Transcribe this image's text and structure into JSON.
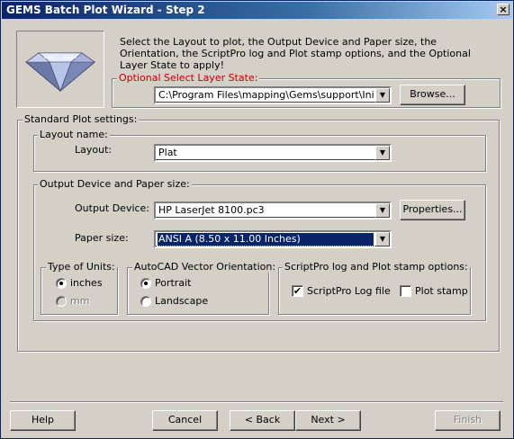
{
  "window": {
    "title": "GEMS Batch Plot Wizard - Step 2",
    "close_glyph": "×"
  },
  "intro_text": "Select the Layout to plot, the Output Device and Paper size, the Orientation, the ScriptPro log and Plot stamp options, and the Optional Layer State to apply!",
  "layer_state": {
    "label": "Optional Select Layer State:",
    "value": "C:\\Program Files\\mapping\\Gems\\support\\Initial.las",
    "browse_label": "Browse..."
  },
  "standard": {
    "label": "Standard Plot settings:",
    "layout_group": "Layout name:",
    "layout_label": "Layout:",
    "layout_value": "Plat",
    "output_group": "Output Device and Paper size:",
    "device_label": "Output Device:",
    "device_value": "HP LaserJet 8100.pc3",
    "properties_label": "Properties...",
    "paper_label": "Paper size:",
    "paper_value": "ANSI A (8.50 x 11.00 Inches)"
  },
  "units": {
    "group": "Type of Units:",
    "inches": "inches",
    "mm": "mm",
    "selected": "inches"
  },
  "orientation": {
    "group": "AutoCAD Vector Orientation:",
    "portrait": "Portrait",
    "landscape": "Landscape",
    "selected": "portrait"
  },
  "scriptpro": {
    "group": "ScriptPro log and Plot stamp options:",
    "log_label": "ScriptPro Log file",
    "log_checked": true,
    "stamp_label": "Plot stamp",
    "stamp_checked": false,
    "check_glyph": "✔"
  },
  "footer": {
    "help": "Help",
    "cancel": "Cancel",
    "back": "< Back",
    "next": "Next >",
    "finish": "Finish"
  },
  "icons": {
    "dropdown": "▼",
    "gem": "diamond-icon"
  }
}
